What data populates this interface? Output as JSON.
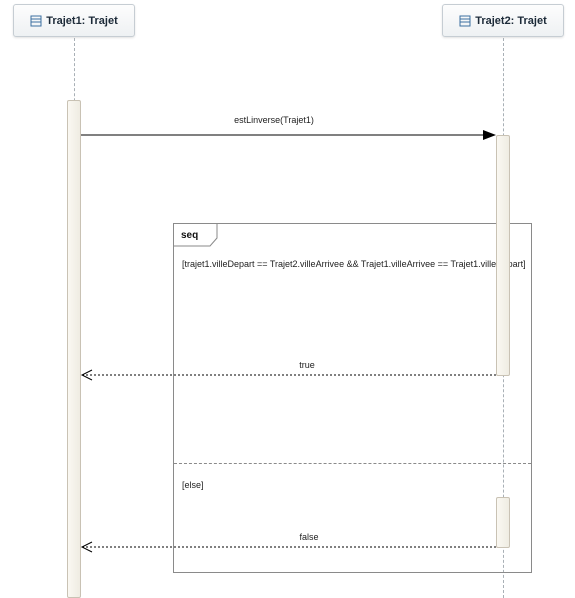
{
  "lifelines": [
    {
      "label": "Trajet1: Trajet",
      "icon": "lifeline-icon"
    },
    {
      "label": "Trajet2: Trajet",
      "icon": "lifeline-icon"
    }
  ],
  "messages": {
    "call": "estLinverse(Trajet1)",
    "return_true": "true",
    "return_false": "false"
  },
  "fragment": {
    "operator": "seq",
    "guard_1": "[trajet1.villeDepart == Trajet2.villeArrivee && Trajet1.villeArrivee == Trajet1.villeDepart]",
    "guard_2": "[else]"
  },
  "colors": {
    "lifeline_border": "#c6cdd3",
    "activation_fill": "#f5f2ea",
    "frame_border": "#8a8a8a",
    "arrow": "#000000"
  }
}
